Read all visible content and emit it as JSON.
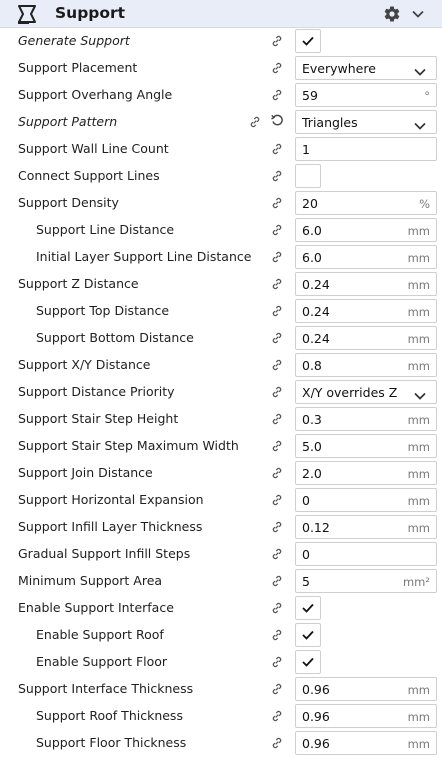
{
  "header": {
    "title": "Support",
    "category_icon": "support-category-icon",
    "settings_icon": "gear-icon",
    "collapse_icon": "chevron-down-icon"
  },
  "rows": [
    {
      "label": "Generate Support",
      "italic": true,
      "control": "checkbox",
      "checked": true
    },
    {
      "label": "Support Placement",
      "control": "dropdown",
      "value": "Everywhere"
    },
    {
      "label": "Support Overhang Angle",
      "control": "input",
      "value": "59",
      "unit": "°"
    },
    {
      "label": "Support Pattern",
      "italic": true,
      "control": "dropdown",
      "value": "Triangles",
      "reset": true
    },
    {
      "label": "Support Wall Line Count",
      "control": "input",
      "value": "1",
      "unit": ""
    },
    {
      "label": "Connect Support Lines",
      "control": "checkbox",
      "checked": false
    },
    {
      "label": "Support Density",
      "control": "input",
      "value": "20",
      "unit": "%"
    },
    {
      "label": "Support Line Distance",
      "sub": true,
      "control": "input",
      "value": "6.0",
      "unit": "mm"
    },
    {
      "label": "Initial Layer Support Line Distance",
      "sub": true,
      "control": "input",
      "value": "6.0",
      "unit": "mm"
    },
    {
      "label": "Support Z Distance",
      "control": "input",
      "value": "0.24",
      "unit": "mm"
    },
    {
      "label": "Support Top Distance",
      "sub": true,
      "control": "input",
      "value": "0.24",
      "unit": "mm"
    },
    {
      "label": "Support Bottom Distance",
      "sub": true,
      "control": "input",
      "value": "0.24",
      "unit": "mm"
    },
    {
      "label": "Support X/Y Distance",
      "control": "input",
      "value": "0.8",
      "unit": "mm"
    },
    {
      "label": "Support Distance Priority",
      "control": "dropdown",
      "value": "X/Y overrides Z"
    },
    {
      "label": "Support Stair Step Height",
      "control": "input",
      "value": "0.3",
      "unit": "mm"
    },
    {
      "label": "Support Stair Step Maximum Width",
      "control": "input",
      "value": "5.0",
      "unit": "mm"
    },
    {
      "label": "Support Join Distance",
      "control": "input",
      "value": "2.0",
      "unit": "mm"
    },
    {
      "label": "Support Horizontal Expansion",
      "control": "input",
      "value": "0",
      "unit": "mm"
    },
    {
      "label": "Support Infill Layer Thickness",
      "control": "input",
      "value": "0.12",
      "unit": "mm"
    },
    {
      "label": "Gradual Support Infill Steps",
      "control": "input",
      "value": "0",
      "unit": ""
    },
    {
      "label": "Minimum Support Area",
      "control": "input",
      "value": "5",
      "unit": "mm²"
    },
    {
      "label": "Enable Support Interface",
      "control": "checkbox",
      "checked": true
    },
    {
      "label": "Enable Support Roof",
      "sub": true,
      "control": "checkbox",
      "checked": true
    },
    {
      "label": "Enable Support Floor",
      "sub": true,
      "control": "checkbox",
      "checked": true
    },
    {
      "label": "Support Interface Thickness",
      "control": "input",
      "value": "0.96",
      "unit": "mm"
    },
    {
      "label": "Support Roof Thickness",
      "sub": true,
      "control": "input",
      "value": "0.96",
      "unit": "mm"
    },
    {
      "label": "Support Floor Thickness",
      "sub": true,
      "control": "input",
      "value": "0.96",
      "unit": "mm"
    }
  ]
}
